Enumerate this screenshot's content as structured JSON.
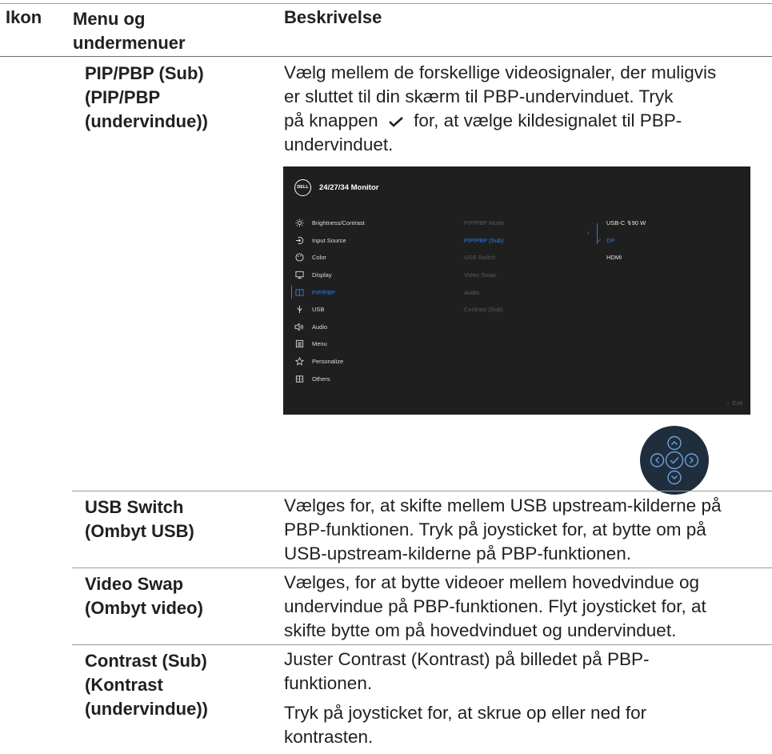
{
  "header": {
    "col_icon": "Ikon",
    "col_menu": "Menu og undermenuer",
    "col_desc": "Beskrivelse"
  },
  "rows": [
    {
      "name_lines": [
        "PIP/PBP (Sub)",
        "(PIP/PBP",
        "(undervindue))"
      ],
      "desc_lines": [
        "Vælg mellem de forskellige videosignaler, der muligvis",
        "er sluttet til din skærm til PBP-undervinduet. Tryk",
        "på knappen",
        "for, at vælge kildesignalet til PBP-",
        "undervinduet."
      ]
    },
    {
      "name_lines": [
        "USB Switch",
        "(Ombyt USB)"
      ],
      "desc_lines": [
        "Vælges for, at skifte mellem USB upstream-kilderne på",
        "PBP-funktionen. Tryk på joysticket for, at bytte om på",
        "USB-upstream-kilderne på PBP-funktionen."
      ]
    },
    {
      "name_lines": [
        "Video Swap",
        "(Ombyt video)"
      ],
      "desc_lines": [
        "Vælges, for at bytte videoer mellem hovedvindue og",
        "undervindue på PBP-funktionen. Flyt joysticket for, at",
        "skifte bytte om på hovedvinduet og undervinduet."
      ]
    },
    {
      "name_lines": [
        "Contrast (Sub)",
        "(Kontrast",
        "(undervindue))"
      ],
      "desc_lines": [
        "Juster Contrast (Kontrast) på billedet på PBP-",
        "funktionen.",
        "Tryk på joysticket for, at skrue op eller ned for",
        "kontrasten."
      ]
    }
  ],
  "osd": {
    "logo": "DELL",
    "title": "24/27/34 Monitor",
    "menu": [
      {
        "label": "Brightness/Contrast",
        "icon": "sun-icon"
      },
      {
        "label": "Input Source",
        "icon": "input-icon"
      },
      {
        "label": "Color",
        "icon": "palette-icon"
      },
      {
        "label": "Display",
        "icon": "monitor-icon"
      },
      {
        "label": "PIP/PBP",
        "icon": "pip-icon"
      },
      {
        "label": "USB",
        "icon": "usb-icon"
      },
      {
        "label": "Audio",
        "icon": "speaker-icon"
      },
      {
        "label": "Menu",
        "icon": "menu-icon"
      },
      {
        "label": "Personalize",
        "icon": "star-icon"
      },
      {
        "label": "Others",
        "icon": "others-icon"
      }
    ],
    "active_menu": "PIP/PBP",
    "submenu": [
      "PIP/PBP Mode",
      "PIP/PBP (Sub)",
      "USB Switch",
      "Video Swap",
      "Audio",
      "Contrast (Sub)"
    ],
    "active_sub": "PIP/PBP (Sub)",
    "options": [
      "USB-C ↯90 W",
      "DP",
      "HDMI"
    ],
    "selected_option": "DP",
    "exit_label": "Exit",
    "colors": {
      "accent": "#2f7de1",
      "background": "#1f1f1f"
    }
  },
  "joystick": {
    "icon": "joystick-icon"
  }
}
